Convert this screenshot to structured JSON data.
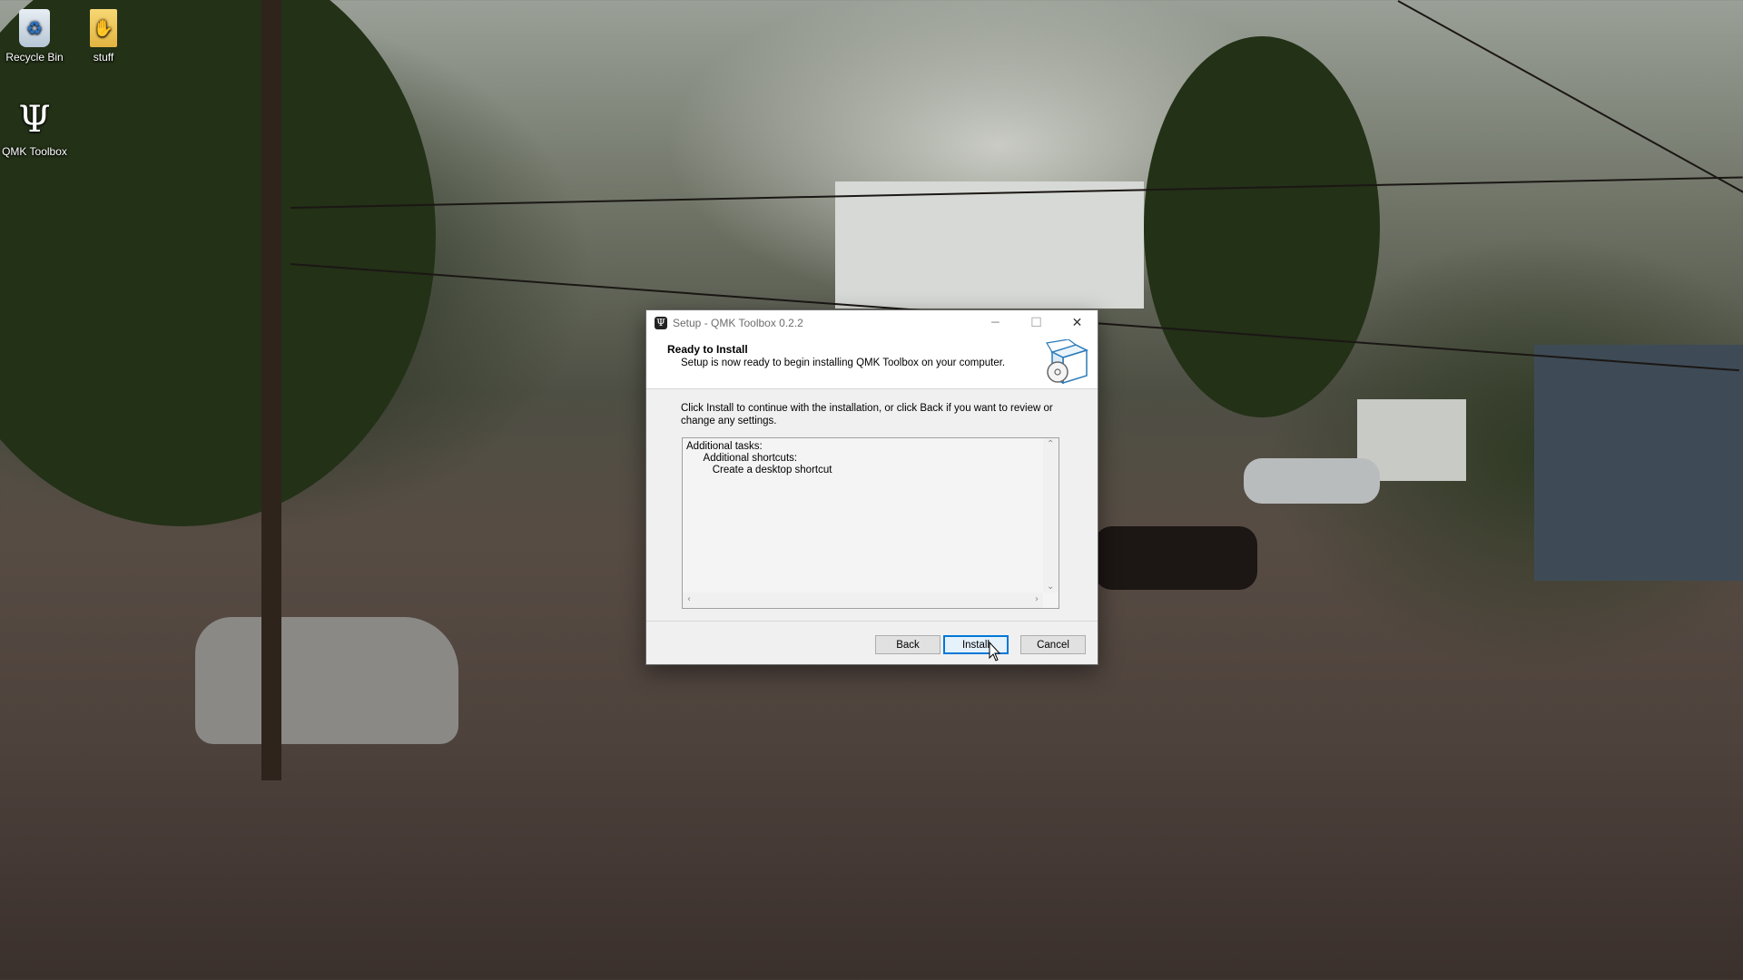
{
  "desktop": {
    "icons": [
      {
        "label": "Recycle Bin",
        "icon": "recycle-bin-icon"
      },
      {
        "label": "stuff",
        "icon": "folder-icon"
      },
      {
        "label": "QMK Toolbox",
        "icon": "qmk-toolbox-icon"
      }
    ]
  },
  "dialog": {
    "title": "Setup - QMK Toolbox 0.2.2",
    "window_buttons": {
      "minimize": "─",
      "maximize": "☐",
      "close": "✕"
    },
    "header": {
      "title": "Ready to Install",
      "subtitle": "Setup is now ready to begin installing QMK Toolbox on your computer."
    },
    "intro": "Click Install to continue with the installation, or click Back if you want to review or change any settings.",
    "memo": {
      "lines": [
        "Additional tasks:",
        "      Additional shortcuts:",
        "         Create a desktop shortcut"
      ]
    },
    "buttons": {
      "back": "Back",
      "install": "Install",
      "cancel": "Cancel"
    }
  },
  "colors": {
    "accent": "#0078d7",
    "dialog_bg": "#f0f0f0"
  }
}
